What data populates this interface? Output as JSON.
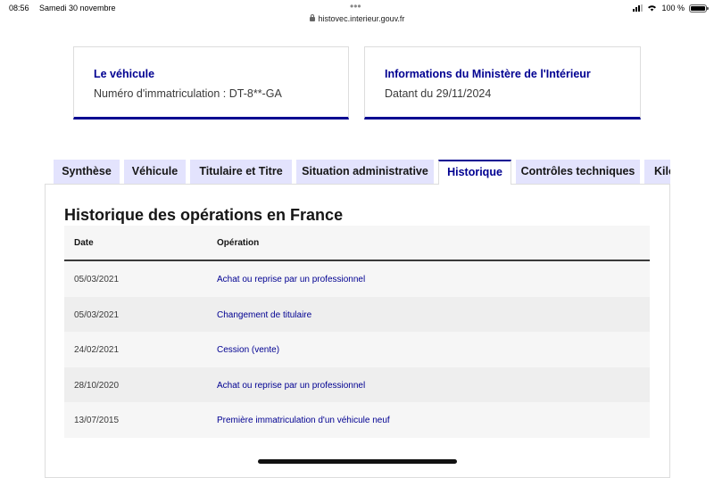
{
  "status_bar": {
    "time": "08:56",
    "date": "Samedi 30 novembre",
    "battery": "100 %"
  },
  "browser": {
    "url": "histovec.interieur.gouv.fr"
  },
  "cards": [
    {
      "title": "Le véhicule",
      "value": "Numéro d'immatriculation : DT-8**-GA"
    },
    {
      "title": "Informations du Ministère de l'Intérieur",
      "value": "Datant du 29/11/2024"
    }
  ],
  "tabs": [
    {
      "label": "Synthèse"
    },
    {
      "label": "Véhicule"
    },
    {
      "label": "Titulaire et Titre"
    },
    {
      "label": "Situation administrative"
    },
    {
      "label": "Historique"
    },
    {
      "label": "Contrôles techniques"
    },
    {
      "label": "Kilométrage"
    }
  ],
  "active_tab": "Historique",
  "section": {
    "title": "Historique des opérations en France",
    "columns": {
      "date": "Date",
      "operation": "Opération"
    },
    "rows": [
      {
        "date": "05/03/2021",
        "operation": "Achat ou reprise par un professionnel"
      },
      {
        "date": "05/03/2021",
        "operation": "Changement de titulaire"
      },
      {
        "date": "24/02/2021",
        "operation": "Cession (vente)"
      },
      {
        "date": "28/10/2020",
        "operation": "Achat ou reprise par un professionnel"
      },
      {
        "date": "13/07/2015",
        "operation": "Première immatriculation d'un véhicule neuf"
      }
    ]
  },
  "colors": {
    "accent": "#000091",
    "tab_bg": "#e3e3fd",
    "row_alt": "#f6f6f6"
  }
}
